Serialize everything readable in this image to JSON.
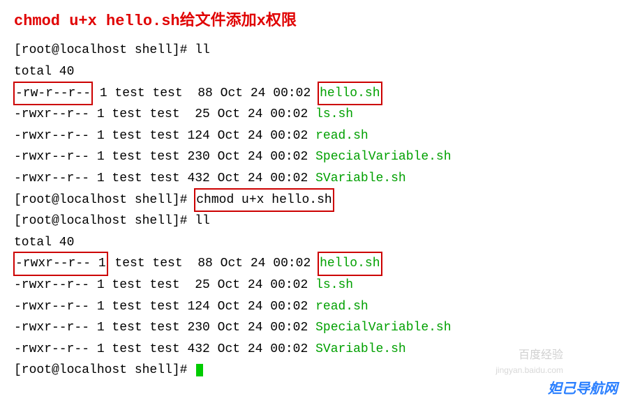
{
  "title": "chmod u+x hello.sh给文件添加x权限",
  "prompt": "[root@localhost shell]# ",
  "cmd_ll": "ll",
  "cmd_chmod": "chmod u+x hello.sh",
  "total": "total 40",
  "listing1": [
    {
      "perm": "-rw-r--r--",
      "link": "1",
      "owner": "test",
      "group": "test",
      "size": " 88",
      "date": "Oct 24 00:02",
      "name": "hello.sh",
      "highlight_perm": true,
      "highlight_name": true
    },
    {
      "perm": "-rwxr--r--",
      "link": "1",
      "owner": "test",
      "group": "test",
      "size": " 25",
      "date": "Oct 24 00:02",
      "name": "ls.sh"
    },
    {
      "perm": "-rwxr--r--",
      "link": "1",
      "owner": "test",
      "group": "test",
      "size": "124",
      "date": "Oct 24 00:02",
      "name": "read.sh"
    },
    {
      "perm": "-rwxr--r--",
      "link": "1",
      "owner": "test",
      "group": "test",
      "size": "230",
      "date": "Oct 24 00:02",
      "name": "SpecialVariable.sh"
    },
    {
      "perm": "-rwxr--r--",
      "link": "1",
      "owner": "test",
      "group": "test",
      "size": "432",
      "date": "Oct 24 00:02",
      "name": "SVariable.sh"
    }
  ],
  "listing2": [
    {
      "perm": "-rwxr--r--",
      "link": "1",
      "owner": "test",
      "group": "test",
      "size": " 88",
      "date": "Oct 24 00:02",
      "name": "hello.sh",
      "highlight_perm_link": true,
      "highlight_name": true
    },
    {
      "perm": "-rwxr--r--",
      "link": "1",
      "owner": "test",
      "group": "test",
      "size": " 25",
      "date": "Oct 24 00:02",
      "name": "ls.sh"
    },
    {
      "perm": "-rwxr--r--",
      "link": "1",
      "owner": "test",
      "group": "test",
      "size": "124",
      "date": "Oct 24 00:02",
      "name": "read.sh"
    },
    {
      "perm": "-rwxr--r--",
      "link": "1",
      "owner": "test",
      "group": "test",
      "size": "230",
      "date": "Oct 24 00:02",
      "name": "SpecialVariable.sh"
    },
    {
      "perm": "-rwxr--r--",
      "link": "1",
      "owner": "test",
      "group": "test",
      "size": "432",
      "date": "Oct 24 00:02",
      "name": "SVariable.sh"
    }
  ],
  "watermark1": "百度经验",
  "watermark2": "jingyan.baidu.com",
  "footer": "妲己导航网"
}
